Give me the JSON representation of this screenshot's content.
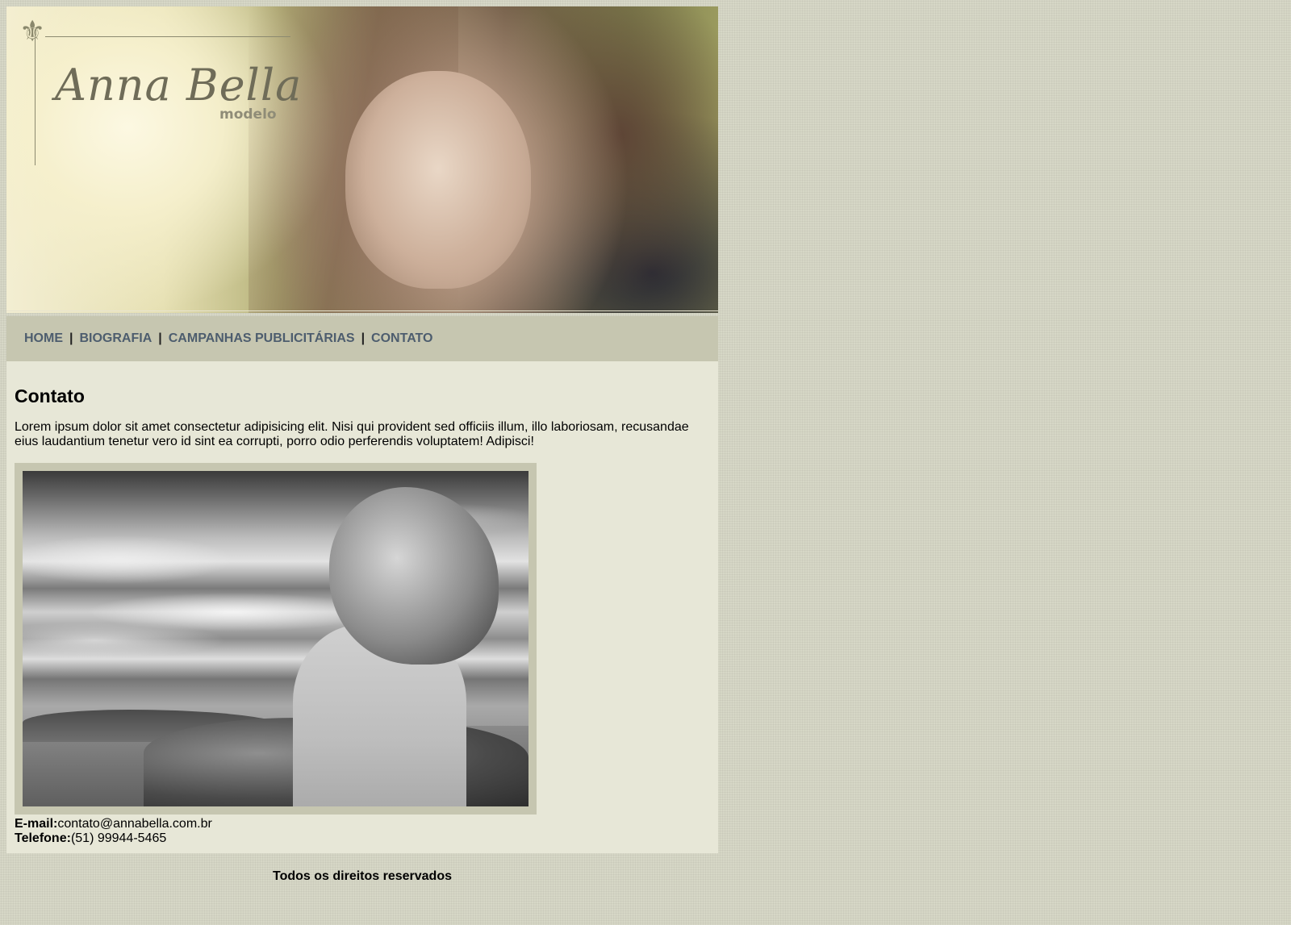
{
  "banner": {
    "logo_title": "Anna Bella",
    "logo_subtitle": "modelo",
    "fleur_icon": "fleur-de-lis-icon"
  },
  "nav": {
    "items": [
      {
        "label": "HOME"
      },
      {
        "label": "BIOGRAFIA"
      },
      {
        "label": "CAMPANHAS PUBLICITÁRIAS"
      },
      {
        "label": "CONTATO"
      }
    ],
    "separator": "|",
    "link_color": "#4d5d6e"
  },
  "main": {
    "title": "Contato",
    "paragraph": "Lorem ipsum dolor sit amet consectetur adipisicing elit. Nisi qui provident sed officiis illum, illo laboriosam, recusandae eius laudantium tenetur vero id sint ea corrupti, porro odio perferendis voluptatem! Adipisci!",
    "contact": {
      "email_label": "E-mail:",
      "email_value": "contato@annabella.com.br",
      "phone_label": "Telefone:",
      "phone_value": "(51) 99944-5465"
    }
  },
  "footer": {
    "text": "Todos os direitos reservados"
  },
  "colors": {
    "page_background": "#d6d7c6",
    "nav_background": "#c6c6b0",
    "content_background": "#e7e7d7"
  }
}
